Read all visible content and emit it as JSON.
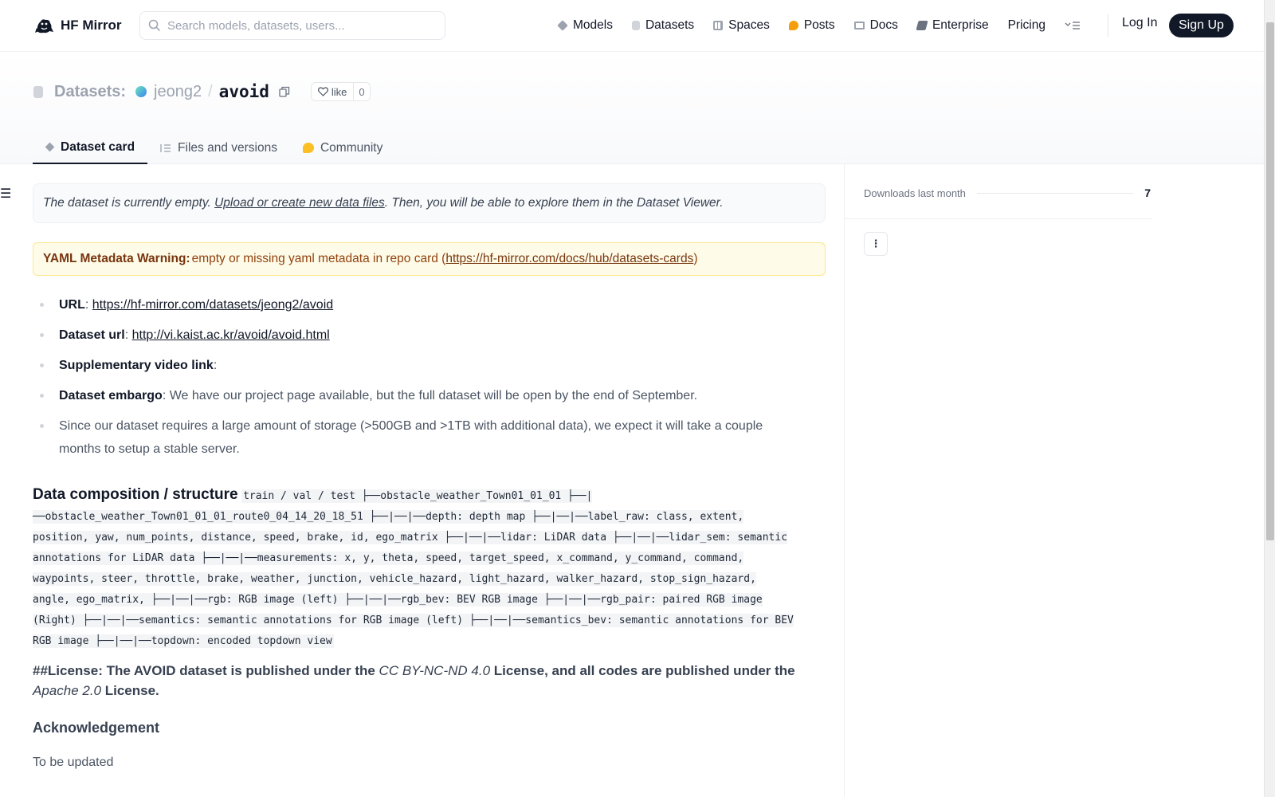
{
  "topnav": {
    "brand": "HF Mirror",
    "search_placeholder": "Search models, datasets, users...",
    "items": [
      {
        "label": "Models",
        "icon": "cube-icon",
        "color": "#9ca3af"
      },
      {
        "label": "Datasets",
        "icon": "database-icon",
        "color": "#d1d5db"
      },
      {
        "label": "Spaces",
        "icon": "grid-icon",
        "color": "#9ca3af"
      },
      {
        "label": "Posts",
        "icon": "chat-bubble-icon",
        "color": "#f59e0b"
      },
      {
        "label": "Docs",
        "icon": "book-icon",
        "color": "#9ca3af"
      },
      {
        "label": "Enterprise",
        "icon": "enterprise-icon",
        "color": "#6b7280"
      },
      {
        "label": "Pricing",
        "icon": "",
        "color": ""
      }
    ],
    "login": "Log In",
    "signup": "Sign Up"
  },
  "repo": {
    "type_label": "Datasets:",
    "owner": "jeong2",
    "name": "avoid",
    "like_label": "like",
    "like_count": "0"
  },
  "tabs": [
    {
      "label": "Dataset card",
      "icon": "card-icon",
      "active": true
    },
    {
      "label": "Files and versions",
      "icon": "files-icon",
      "active": false
    },
    {
      "label": "Community",
      "icon": "community-icon",
      "active": false
    }
  ],
  "notice": {
    "before": "The dataset is currently empty. ",
    "link": "Upload or create new data files",
    "after": ". Then, you will be able to explore them in the Dataset Viewer."
  },
  "yaml_warning": {
    "title": "YAML Metadata Warning:",
    "text": " empty or missing yaml metadata in repo card (",
    "link": "https://hf-mirror.com/docs/hub/datasets-cards",
    "close": ")"
  },
  "facts": [
    {
      "label": "URL",
      "sep": ": ",
      "link": "https://hf-mirror.com/datasets/jeong2/avoid",
      "text": ""
    },
    {
      "label": "Dataset url",
      "sep": ": ",
      "link": "http://vi.kaist.ac.kr/avoid/avoid.html",
      "text": ""
    },
    {
      "label": "Supplementary video link",
      "sep": ":",
      "link": "",
      "text": ""
    },
    {
      "label": "Dataset embargo",
      "sep": ": ",
      "link": "",
      "text": "We have our project page available, but the full dataset will be open by the end of September."
    },
    {
      "label": "",
      "sep": "",
      "link": "",
      "text": "Since our dataset requires a large amount of storage (>500GB and >1TB with additional data), we expect it will take a couple months to setup a stable server."
    }
  ],
  "composition": {
    "heading": "Data composition / structure",
    "code": "train / val / test ├──obstacle_weather_Town01_01_01 ├──|──obstacle_weather_Town01_01_01_route0_04_14_20_18_51 ├──|──|──depth: depth map ├──|──|──label_raw: class, extent, position, yaw, num_points, distance, speed, brake, id, ego_matrix ├──|──|──lidar: LiDAR data ├──|──|──lidar_sem: semantic annotations for LiDAR data ├──|──|──measurements: x, y, theta, speed, target_speed, x_command, y_command, command, waypoints, steer, throttle, brake, weather, junction, vehicle_hazard, light_hazard, walker_hazard, stop_sign_hazard, angle, ego_matrix, ├──|──|──rgb: RGB image (left) ├──|──|──rgb_bev: BEV RGB image ├──|──|──rgb_pair: paired RGB image (Right) ├──|──|──semantics: semantic annotations for RGB image (left) ├──|──|──semantics_bev: semantic annotations for BEV RGB image ├──|──|──topdown: encoded topdown view"
  },
  "license": {
    "p1": "##License: The AVOID dataset is published under the ",
    "i1": "CC BY-NC-ND 4.0",
    "p2": " License, and all codes are published under the ",
    "i2": "Apache 2.0",
    "p3": " License."
  },
  "acknowledgement": {
    "heading": "Acknowledgement",
    "body": "To be updated"
  },
  "sidebar": {
    "downloads_label": "Downloads last month",
    "downloads_count": "7",
    "more_label": "⋮"
  }
}
